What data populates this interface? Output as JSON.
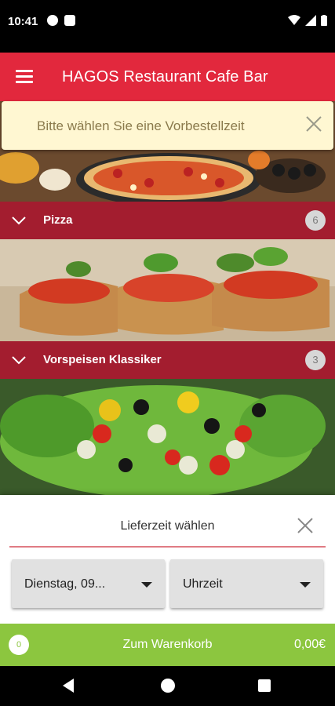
{
  "status_bar": {
    "time": "10:41"
  },
  "app_bar": {
    "title": "HAGOS Restaurant Cafe Bar"
  },
  "banner": {
    "text": "Bitte wählen Sie eine Vorbestellzeit"
  },
  "categories": [
    {
      "label": "Pizza",
      "count": "6"
    },
    {
      "label": "Vorspeisen Klassiker",
      "count": "3"
    }
  ],
  "sheet": {
    "title": "Lieferzeit wählen",
    "date_value": "Dienstag, 09...",
    "time_value": "Uhrzeit"
  },
  "cart": {
    "badge": "0",
    "label": "Zum Warenkorb",
    "total": "0,00€"
  },
  "colors": {
    "primary": "#e2283d",
    "category_bg": "#a31d2f",
    "cart": "#8cc63f",
    "banner": "#fff7d2"
  }
}
